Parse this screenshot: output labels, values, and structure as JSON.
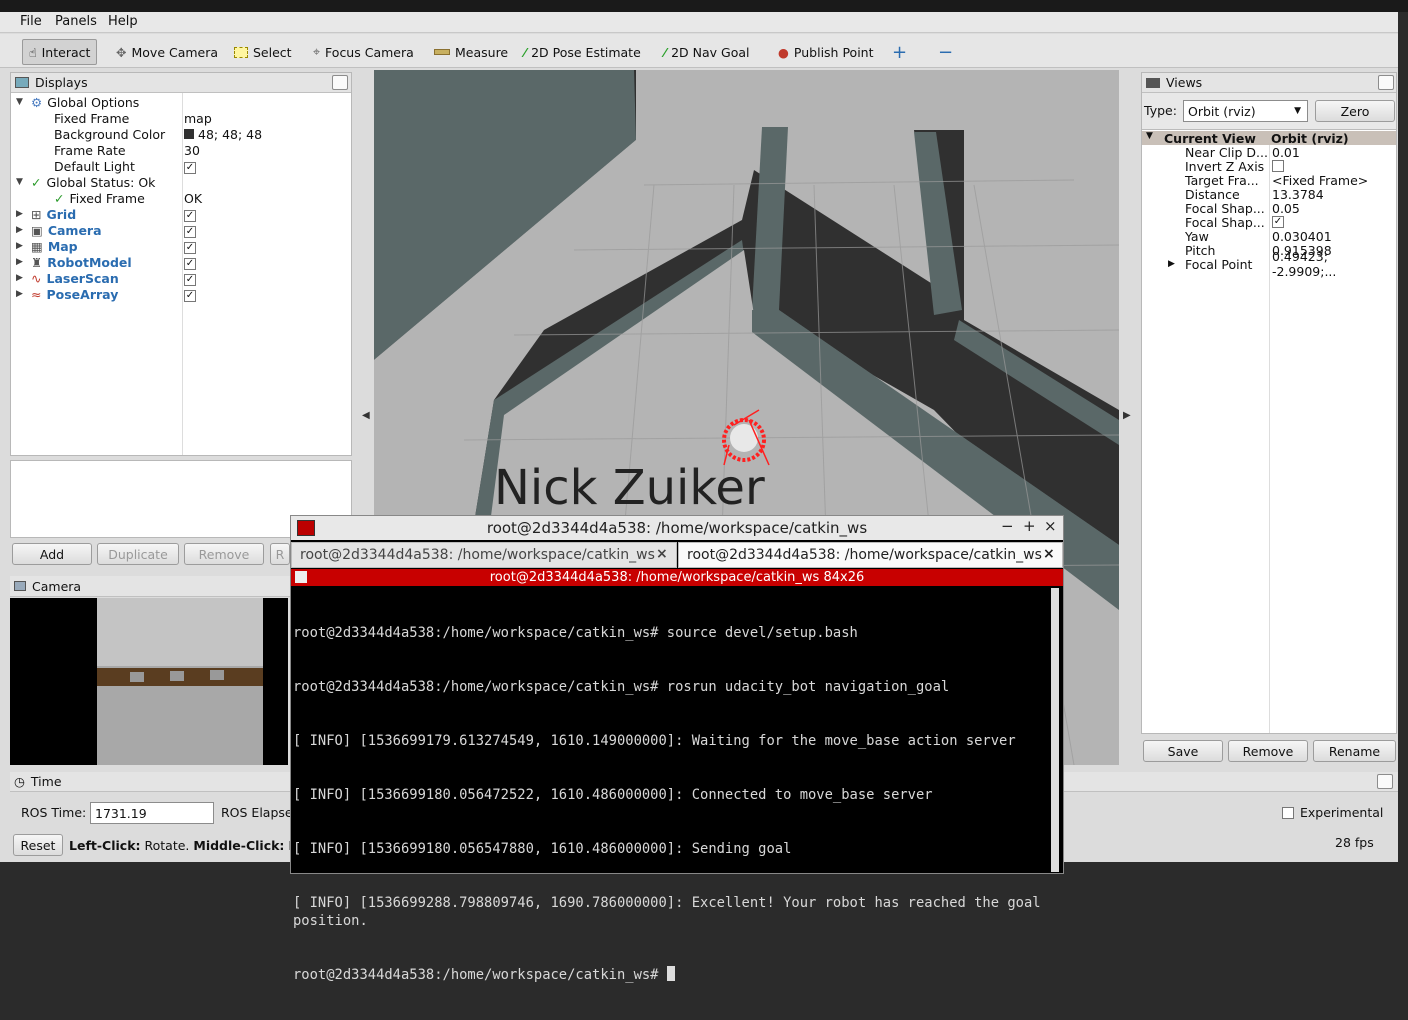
{
  "menu": {
    "file": "File",
    "panels": "Panels",
    "help": "Help"
  },
  "toolbar": {
    "interact": "Interact",
    "move_camera": "Move Camera",
    "select": "Select",
    "focus_camera": "Focus Camera",
    "measure": "Measure",
    "pose_estimate": "2D Pose Estimate",
    "nav_goal": "2D Nav Goal",
    "publish_point": "Publish Point"
  },
  "displays": {
    "title": "Displays",
    "global_options": "Global Options",
    "rows": [
      {
        "label": "Fixed Frame",
        "value": "map"
      },
      {
        "label": "Background Color",
        "value": "48; 48; 48"
      },
      {
        "label": "Frame Rate",
        "value": "30"
      },
      {
        "label": "Default Light",
        "value": "✓"
      }
    ],
    "global_status": "Global Status: Ok",
    "status_fixed_frame": "Fixed Frame",
    "status_value": "OK",
    "items": [
      {
        "label": "Grid",
        "check": "✓"
      },
      {
        "label": "Camera",
        "check": "✓"
      },
      {
        "label": "Map",
        "check": "✓"
      },
      {
        "label": "RobotModel",
        "check": "✓"
      },
      {
        "label": "LaserScan",
        "check": "✓"
      },
      {
        "label": "PoseArray",
        "check": "✓"
      }
    ],
    "buttons": {
      "add": "Add",
      "duplicate": "Duplicate",
      "remove": "Remove",
      "rename": "R"
    }
  },
  "camera_panel": {
    "title": "Camera"
  },
  "viewport": {
    "watermark": "Nick Zuiker",
    "background_color": "#303030"
  },
  "views": {
    "title": "Views",
    "type_label": "Type:",
    "type_value": "Orbit (rviz)",
    "zero": "Zero",
    "header_name": "Current View",
    "header_value": "Orbit (rviz)",
    "rows": [
      {
        "label": "Near Clip D...",
        "value": "0.01"
      },
      {
        "label": "Invert Z Axis",
        "value": ""
      },
      {
        "label": "Target Fra...",
        "value": "<Fixed Frame>"
      },
      {
        "label": "Distance",
        "value": "13.3784"
      },
      {
        "label": "Focal Shap...",
        "value": "0.05"
      },
      {
        "label": "Focal Shap...",
        "value": "✓"
      },
      {
        "label": "Yaw",
        "value": "0.030401"
      },
      {
        "label": "Pitch",
        "value": "0.915398"
      },
      {
        "label": "Focal Point",
        "value": "0.49423; -2.9909;..."
      }
    ],
    "buttons": {
      "save": "Save",
      "remove": "Remove",
      "rename": "Rename"
    }
  },
  "time_panel": {
    "title": "Time",
    "ros_time_label": "ROS Time:",
    "ros_time_value": "1731.19",
    "ros_elapsed_label": "ROS Elapse",
    "experimental": "Experimental",
    "reset": "Reset",
    "hint_left_bold": "Left-Click:",
    "hint_left": " Rotate. ",
    "hint_middle_bold": "Middle-Click:",
    "hint_middle": " M",
    "fps": "28 fps"
  },
  "terminal": {
    "title": "root@2d3344d4a538: /home/workspace/catkin_ws",
    "tab1": "root@2d3344d4a538: /home/workspace/catkin_ws",
    "tab2": "root@2d3344d4a538: /home/workspace/catkin_ws",
    "bar": "root@2d3344d4a538: /home/workspace/catkin_ws 84x26",
    "lines": [
      "root@2d3344d4a538:/home/workspace/catkin_ws# source devel/setup.bash",
      "root@2d3344d4a538:/home/workspace/catkin_ws# rosrun udacity_bot navigation_goal",
      "[ INFO] [1536699179.613274549, 1610.149000000]: Waiting for the move_base action server",
      "[ INFO] [1536699180.056472522, 1610.486000000]: Connected to move_base server",
      "[ INFO] [1536699180.056547880, 1610.486000000]: Sending goal",
      "[ INFO] [1536699288.798809746, 1690.786000000]: Excellent! Your robot has reached the goal position.",
      "root@2d3344d4a538:/home/workspace/catkin_ws# "
    ]
  }
}
